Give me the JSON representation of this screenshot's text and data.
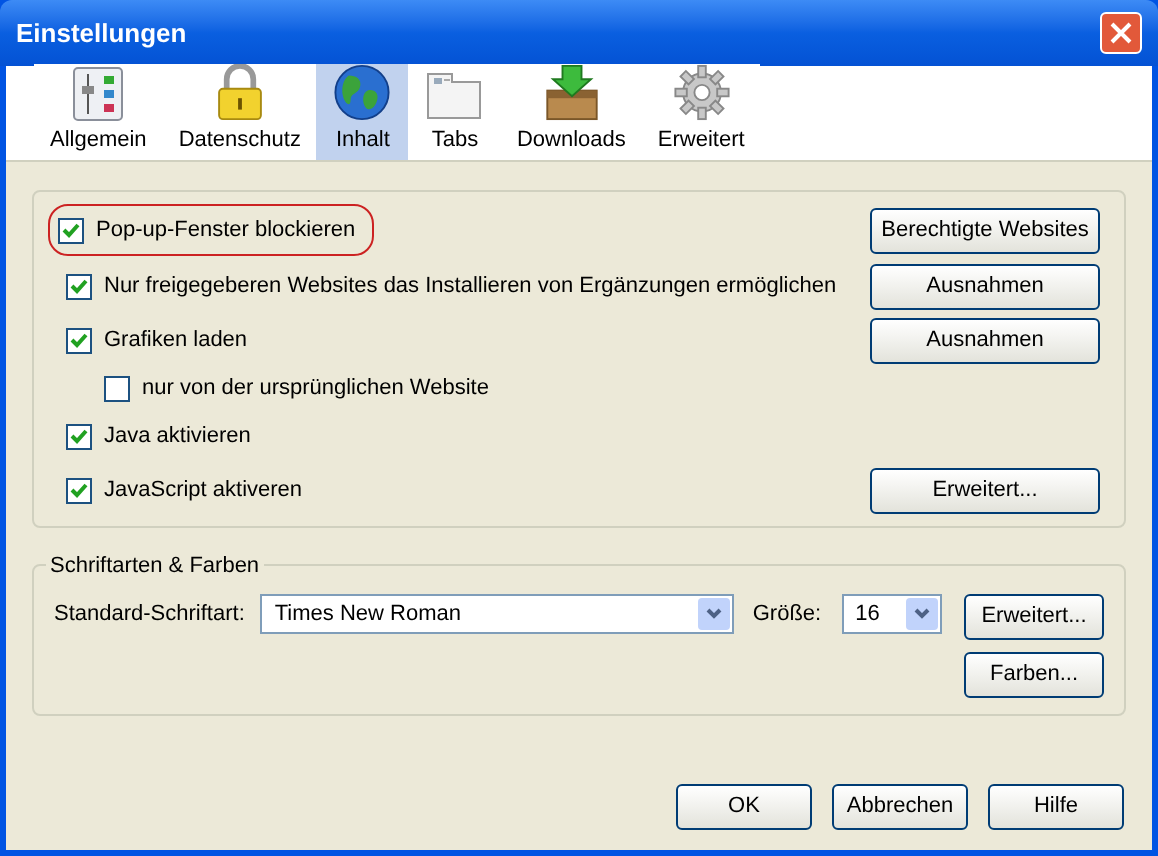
{
  "window": {
    "title": "Einstellungen"
  },
  "tabs": [
    {
      "label": "Allgemein",
      "selected": false
    },
    {
      "label": "Datenschutz",
      "selected": false
    },
    {
      "label": "Inhalt",
      "selected": true
    },
    {
      "label": "Tabs",
      "selected": false
    },
    {
      "label": "Downloads",
      "selected": false
    },
    {
      "label": "Erweitert",
      "selected": false
    }
  ],
  "options": [
    {
      "label": "Pop-up-Fenster blockieren",
      "checked": true,
      "highlighted": true,
      "button": "Berechtigte Websites"
    },
    {
      "label": "Nur freigegeberen Websites das Installieren von Ergänzungen ermöglichen",
      "checked": true,
      "highlighted": false,
      "button": "Ausnahmen"
    },
    {
      "label": "Grafiken laden",
      "checked": true,
      "highlighted": false,
      "button": "Ausnahmen",
      "children": [
        {
          "label": "nur von der ursprünglichen Website",
          "checked": false
        }
      ]
    },
    {
      "label": "Java aktivieren",
      "checked": true,
      "highlighted": false
    },
    {
      "label": "JavaScript aktiveren",
      "checked": true,
      "highlighted": false,
      "button": "Erweitert..."
    }
  ],
  "fonts": {
    "title": "Schriftarten & Farben",
    "font_label": "Standard-Schriftart:",
    "font_value": "Times New Roman",
    "size_label": "Größe:",
    "size_value": "16",
    "advanced_button": "Erweitert...",
    "colors_button": "Farben..."
  },
  "buttons": [
    "OK",
    "Abbrechen",
    "Hilfe"
  ]
}
